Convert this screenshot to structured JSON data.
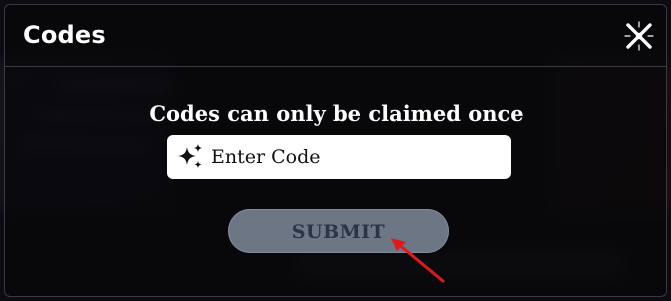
{
  "modal": {
    "title": "Codes",
    "prompt": "Codes can only be claimed once",
    "code_input": {
      "placeholder": "Enter Code",
      "value": "",
      "icon": "sparkles-icon"
    },
    "submit_label": "SUBMIT",
    "close_icon": "close-icon"
  },
  "colors": {
    "modal_bg": "#08080a",
    "submit_bg": "#6c7684",
    "submit_text": "#2a3446",
    "annotation_arrow": "#e01a1a"
  }
}
